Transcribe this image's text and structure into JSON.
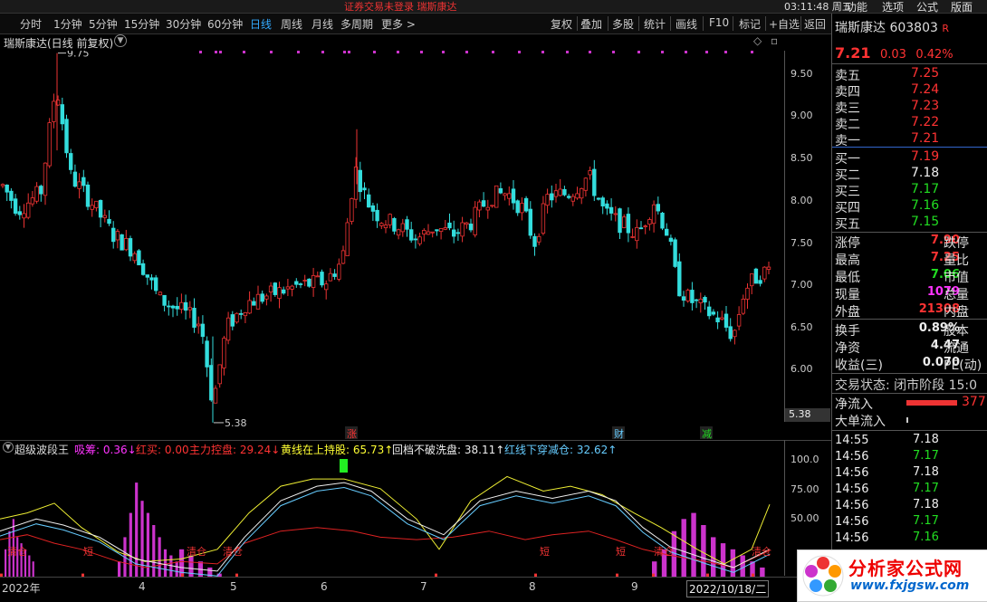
{
  "titlebar": {
    "center": "证券交易未登录  瑞斯康达",
    "clock": "03:11:48 周五",
    "menu": [
      "功能",
      "选项",
      "公式",
      "版面"
    ]
  },
  "toolbar": {
    "periods": [
      "分时",
      "1分钟",
      "5分钟",
      "15分钟",
      "30分钟",
      "60分钟",
      "日线",
      "周线",
      "月线",
      "多周期",
      "更多 >"
    ],
    "active": "日线",
    "right": [
      "复权",
      "叠加",
      "多股",
      "统计",
      "画线",
      "F10",
      "标记",
      "+自选",
      "返回"
    ]
  },
  "chart": {
    "title": "瑞斯康达(日线 前复权)",
    "high_label": "9.75",
    "low_label": "5.38",
    "current_price_box": "5.38",
    "event_markers": [
      "涨",
      "财",
      "减"
    ]
  },
  "chart_data": {
    "type": "candlestick",
    "y_ticks": [
      "9.50",
      "9.00",
      "8.50",
      "8.00",
      "7.50",
      "7.00",
      "6.50",
      "6.00"
    ],
    "ylim": [
      5.3,
      9.9
    ],
    "x_ticks": [
      "2022年",
      "4",
      "5",
      "6",
      "7",
      "8",
      "9",
      "2022/10/18/二"
    ],
    "indicator_y_ticks": [
      "100.0",
      "75.00",
      "50.00"
    ],
    "indicator_ylim": [
      0,
      110
    ]
  },
  "indicator": {
    "name": "超级波段王",
    "items": [
      {
        "label": "吸筹:",
        "value": "0.36",
        "arrow": "↓",
        "color": "#f3f"
      },
      {
        "label": "红买:",
        "value": "0.00",
        "arrow": "",
        "color": "#f33"
      },
      {
        "label": "主力控盘:",
        "value": "29.24",
        "arrow": "↓",
        "color": "#f33"
      },
      {
        "label": "黄线在上持股:",
        "value": "65.73",
        "arrow": "↑",
        "color": "#ff3"
      },
      {
        "label": "回档不破洗盘:",
        "value": "38.11",
        "arrow": "↑",
        "color": "#eee"
      },
      {
        "label": "红线下穿减仓:",
        "value": "32.62",
        "arrow": "↑",
        "color": "#6cf"
      }
    ],
    "chart_texts": [
      "清仓",
      "短",
      "清仓",
      "清仓",
      "短",
      "短",
      "清仓",
      "清仓"
    ]
  },
  "quote": {
    "name": "瑞斯康达",
    "code": "603803",
    "flag": "R",
    "price": "7.21",
    "change": "0.03",
    "pct": "0.42%",
    "asks": [
      {
        "label": "卖五",
        "price": "7.25"
      },
      {
        "label": "卖四",
        "price": "7.24"
      },
      {
        "label": "卖三",
        "price": "7.23"
      },
      {
        "label": "卖二",
        "price": "7.22"
      },
      {
        "label": "卖一",
        "price": "7.21"
      }
    ],
    "bids": [
      {
        "label": "买一",
        "price": "7.19"
      },
      {
        "label": "买二",
        "price": "7.18"
      },
      {
        "label": "买三",
        "price": "7.17"
      },
      {
        "label": "买四",
        "price": "7.16"
      },
      {
        "label": "买五",
        "price": "7.15"
      }
    ],
    "stats": [
      {
        "l1": "涨停",
        "v1": "7.90",
        "c1": "red",
        "l2": "跌停"
      },
      {
        "l1": "最高",
        "v1": "7.25",
        "c1": "red",
        "l2": "量比"
      },
      {
        "l1": "最低",
        "v1": "7.06",
        "c1": "green",
        "l2": "市值"
      },
      {
        "l1": "现量",
        "v1": "1079",
        "c1": "mag",
        "l2": "总量"
      },
      {
        "l1": "外盘",
        "v1": "21308",
        "c1": "red",
        "l2": "内盘"
      },
      {
        "l1": "换手",
        "v1": "0.89%",
        "c1": "white",
        "l2": "股本"
      },
      {
        "l1": "净资",
        "v1": "4.47",
        "c1": "white",
        "l2": "流通"
      },
      {
        "l1": "收益(三)",
        "v1": "0.070",
        "c1": "white",
        "l2": "PE(动)"
      }
    ],
    "trade_status": "交易状态: 闭市阶段 15:0",
    "net_inflow_label": "净流入",
    "net_inflow_value": "377",
    "big_inflow_label": "大单流入",
    "ticks": [
      {
        "time": "14:55",
        "price": "7.18",
        "c": "white"
      },
      {
        "time": "14:56",
        "price": "7.17",
        "c": "green"
      },
      {
        "time": "14:56",
        "price": "7.18",
        "c": "white"
      },
      {
        "time": "14:56",
        "price": "7.17",
        "c": "green"
      },
      {
        "time": "14:56",
        "price": "7.18",
        "c": "white"
      },
      {
        "time": "14:56",
        "price": "7.17",
        "c": "green"
      },
      {
        "time": "14:56",
        "price": "7.16",
        "c": "green"
      }
    ]
  },
  "watermark": {
    "line1": "分析家公式网",
    "line2": "www.fxjgsw.com"
  }
}
